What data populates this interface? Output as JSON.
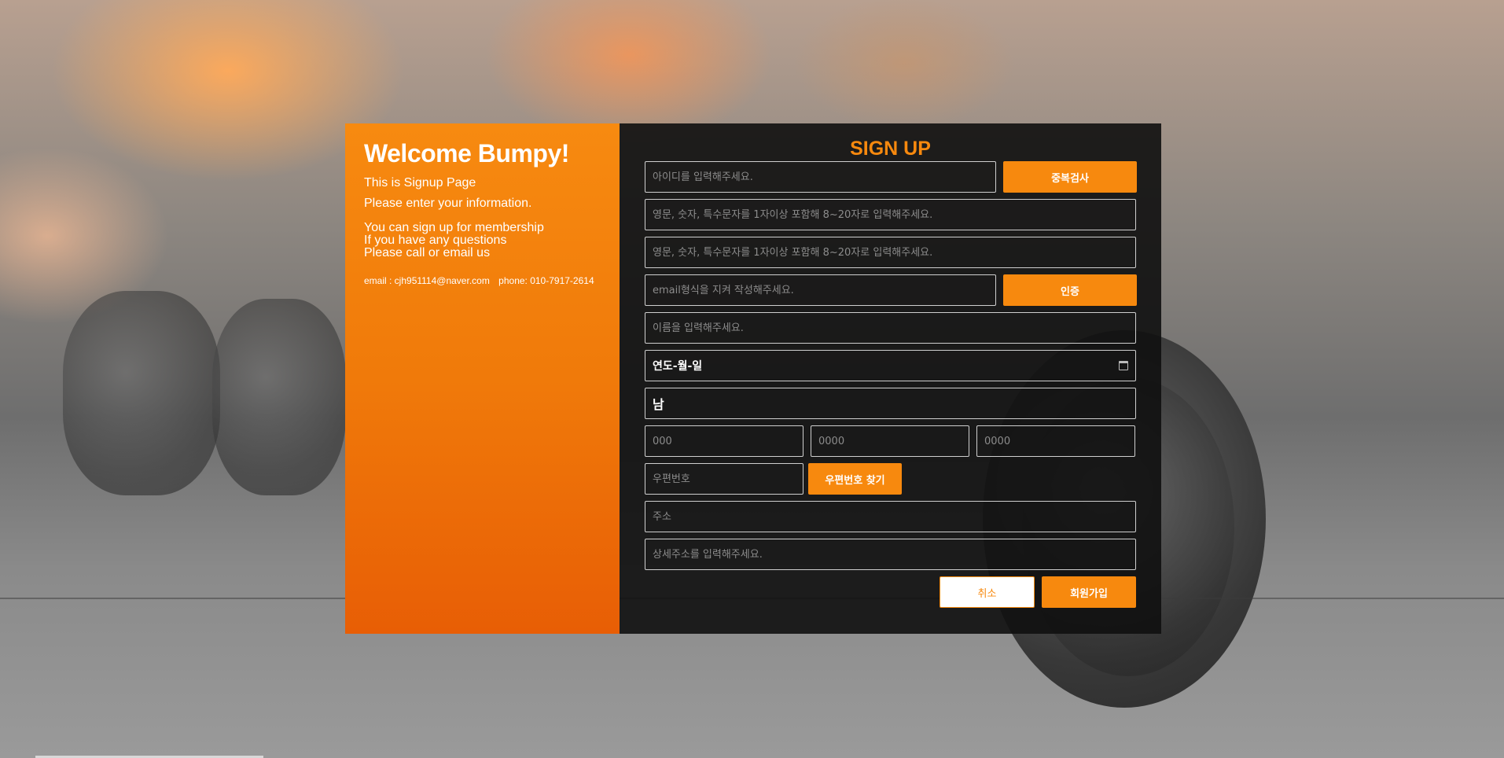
{
  "left": {
    "title": "Welcome Bumpy!",
    "line1": "This is Signup Page",
    "line2": "Please enter your information.",
    "block1": "You can sign up for membership",
    "block2": "If you have any questions",
    "block3": "Please call or email us",
    "email": "email : cjh951114@naver.com",
    "phone": "phone: 010-7917-2614"
  },
  "form": {
    "title": "SIGN UP",
    "id_placeholder": "아이디를 입력해주세요.",
    "dup_check_label": "중복검사",
    "pw_placeholder": "영문, 숫자, 특수문자를 1자이상 포함해 8~20자로 입력해주세요.",
    "pw_confirm_placeholder": "영문, 숫자, 특수문자를 1자이상 포함해 8~20자로 입력해주세요.",
    "email_placeholder": "email형식을 지켜 작성해주세요.",
    "verify_label": "인증",
    "name_placeholder": "이름을 입력해주세요.",
    "birth_value": "연도-월-일",
    "gender_value": "남",
    "tel1_placeholder": "000",
    "tel2_placeholder": "0000",
    "tel3_placeholder": "0000",
    "postcode_placeholder": "우편번호",
    "find_postcode_label": "우편번호 찾기",
    "address_placeholder": "주소",
    "detail_address_placeholder": "상세주소를 입력해주세요.",
    "cancel_label": "취소",
    "submit_label": "회원가입"
  },
  "colors": {
    "accent": "#f7890e",
    "panel_dark": "#0f0f0f",
    "left_gradient_top": "#f78a10",
    "left_gradient_bottom": "#e85e05"
  }
}
